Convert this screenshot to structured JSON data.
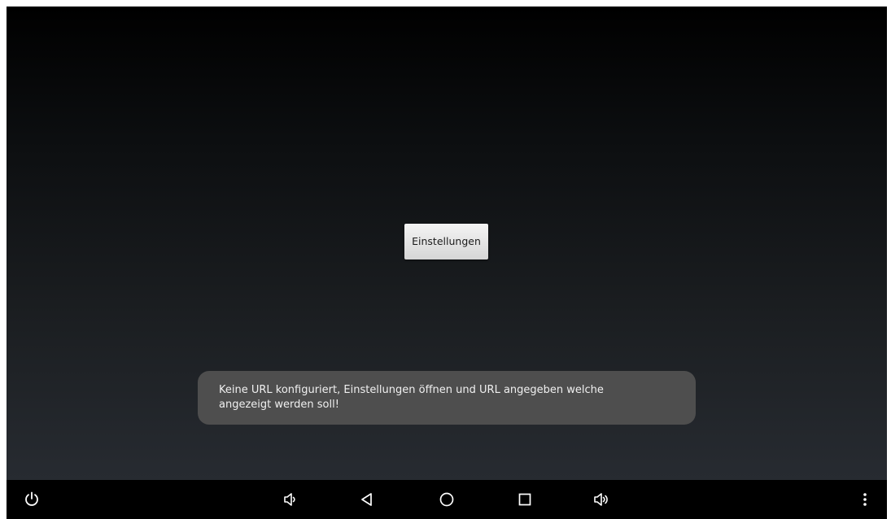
{
  "app": {
    "settings_button_label": "Einstellungen"
  },
  "toast": {
    "message": "Keine URL konfiguriert, Einstellungen öffnen und URL angegeben welche angezeigt werden soll!"
  },
  "navbar": {
    "icons": [
      "power-icon",
      "volume-down-icon",
      "back-icon",
      "home-icon",
      "recent-apps-icon",
      "volume-up-icon",
      "more-menu-icon"
    ],
    "icon_color": "#ffffff"
  },
  "colors": {
    "background_top": "#000000",
    "background_bottom": "#272b31",
    "toast_background": "#4e4e4e",
    "navbar_background": "#000000"
  }
}
